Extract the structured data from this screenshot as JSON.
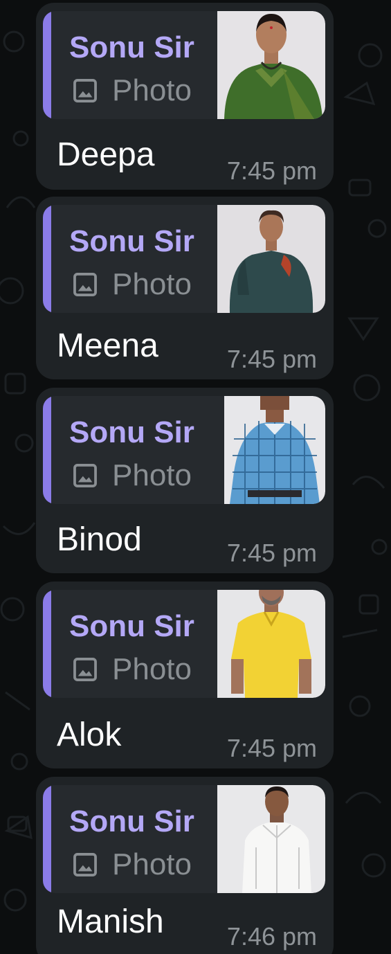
{
  "colors": {
    "background": "#0c0e0f",
    "bubble": "#1f2326",
    "quote_background": "#262a2e",
    "quote_accent_bar": "#8b7ce8",
    "sender_name": "#b4a8f6",
    "media_label": "#8a8f93",
    "message_text": "#ffffff",
    "time_text": "#8f9498"
  },
  "messages": [
    {
      "reply": {
        "sender": "Sonu Sir",
        "media_icon": "image-icon",
        "media_label": "Photo"
      },
      "text": "Deepa",
      "time": "7:45 pm"
    },
    {
      "reply": {
        "sender": "Sonu Sir",
        "media_icon": "image-icon",
        "media_label": "Photo"
      },
      "text": "Meena",
      "time": "7:45 pm"
    },
    {
      "reply": {
        "sender": "Sonu Sir",
        "media_icon": "image-icon",
        "media_label": "Photo"
      },
      "text": "Binod",
      "time": "7:45 pm"
    },
    {
      "reply": {
        "sender": "Sonu Sir",
        "media_icon": "image-icon",
        "media_label": "Photo"
      },
      "text": "Alok",
      "time": "7:45 pm"
    },
    {
      "reply": {
        "sender": "Sonu Sir",
        "media_icon": "image-icon",
        "media_label": "Photo"
      },
      "text": "Manish",
      "time": "7:46 pm"
    }
  ]
}
